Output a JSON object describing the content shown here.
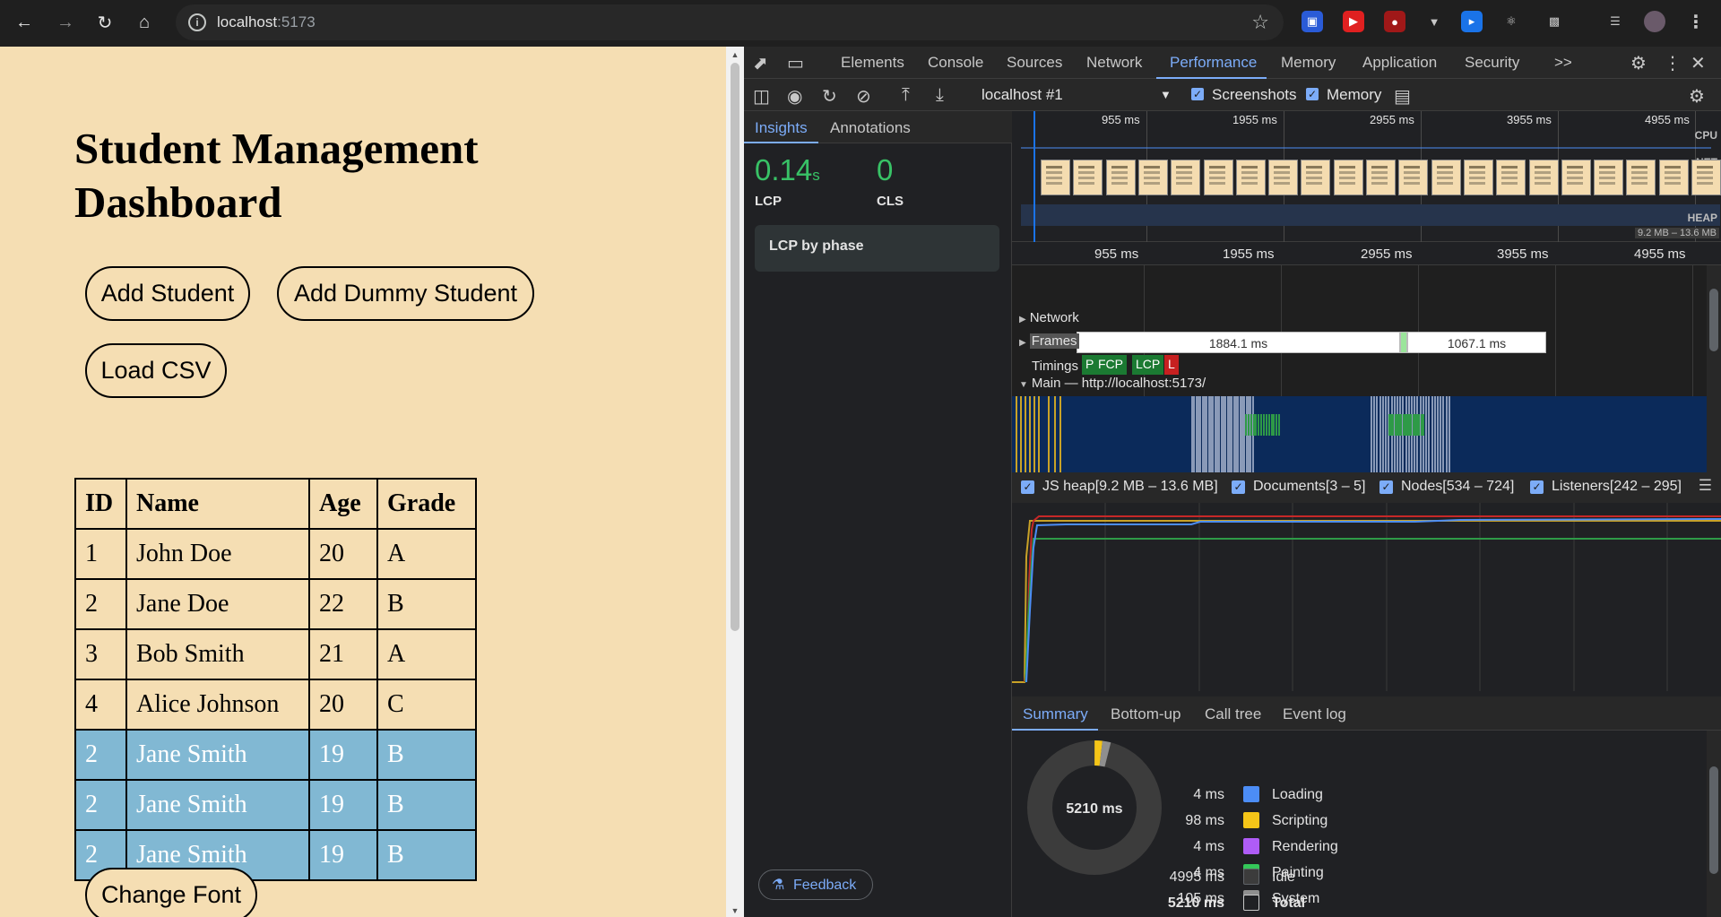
{
  "browser": {
    "url_host": "localhost",
    "url_port": ":5173"
  },
  "page": {
    "title": "Student Management Dashboard",
    "buttons": {
      "add_student": "Add Student",
      "add_dummy": "Add Dummy Student",
      "load_csv": "Load CSV",
      "change_font": "Change Font"
    },
    "table": {
      "headers": [
        "ID",
        "Name",
        "Age",
        "Grade"
      ],
      "rows": [
        [
          "1",
          "John Doe",
          "20",
          "A"
        ],
        [
          "2",
          "Jane Doe",
          "22",
          "B"
        ],
        [
          "3",
          "Bob Smith",
          "21",
          "A"
        ],
        [
          "4",
          "Alice Johnson",
          "20",
          "C"
        ],
        [
          "2",
          "Jane Smith",
          "19",
          "B"
        ],
        [
          "2",
          "Jane Smith",
          "19",
          "B"
        ],
        [
          "2",
          "Jane Smith",
          "19",
          "B"
        ]
      ],
      "highlight_color": "#81b8d3"
    }
  },
  "devtools": {
    "tabs": [
      "Elements",
      "Console",
      "Sources",
      "Network",
      "Performance",
      "Memory",
      "Application",
      "Security"
    ],
    "active_tab": "Performance",
    "more_tabs": ">>",
    "toolbar": {
      "session": "localhost #1",
      "screenshots": "Screenshots",
      "memory": "Memory"
    },
    "insights": {
      "tabs": [
        "Insights",
        "Annotations"
      ],
      "lcp_value": "0.14",
      "lcp_unit": "s",
      "lcp_label": "LCP",
      "cls_value": "0",
      "cls_label": "CLS",
      "lcp_phase": "LCP by phase",
      "feedback": "Feedback"
    },
    "overview": {
      "ticks": [
        "955 ms",
        "1955 ms",
        "2955 ms",
        "3955 ms",
        "4955 ms"
      ],
      "tracks": [
        "CPU",
        "NET",
        "HEAP"
      ],
      "heap_range": "9.2 MB – 13.6 MB"
    },
    "ruler": [
      "955 ms",
      "1955 ms",
      "2955 ms",
      "3955 ms",
      "4955 ms"
    ],
    "tracks": {
      "network": "Network",
      "frames": "Frames",
      "frame_1": "1884.1 ms",
      "frame_2": "1067.1 ms",
      "timings": "Timings",
      "timing_chips": [
        "P",
        "FCP",
        "LCP",
        "L"
      ],
      "main": "Main — http://localhost:5173/"
    },
    "counters": [
      {
        "label": "JS heap[9.2 MB – 13.6 MB]",
        "color": "#1a3a6e"
      },
      {
        "label": "Documents[3 – 5]",
        "color": "#8b1a1a"
      },
      {
        "label": "Nodes[534 – 724]",
        "color": "#1b7a32"
      },
      {
        "label": "Listeners[242 – 295]",
        "color": "#8a6a14"
      }
    ],
    "summary": {
      "tabs": [
        "Summary",
        "Bottom-up",
        "Call tree",
        "Event log"
      ],
      "total_center": "5210 ms",
      "rows": [
        {
          "value": "4 ms",
          "label": "Loading",
          "color": "#4c8df6"
        },
        {
          "value": "98 ms",
          "label": "Scripting",
          "color": "#f5c518"
        },
        {
          "value": "4 ms",
          "label": "Rendering",
          "color": "#af5cf7"
        },
        {
          "value": "4 ms",
          "label": "Painting",
          "color": "#34c759"
        },
        {
          "value": "105 ms",
          "label": "System",
          "color": "#8f8f8f"
        },
        {
          "value": "4995 ms",
          "label": "Idle",
          "color": "#3c3c3c"
        },
        {
          "value": "5210 ms",
          "label": "Total",
          "color": "#202124"
        }
      ]
    }
  }
}
